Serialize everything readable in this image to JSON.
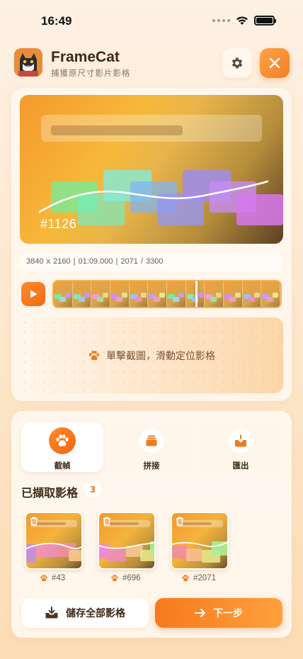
{
  "status_bar": {
    "time": "16:49"
  },
  "header": {
    "title": "FrameCat",
    "subtitle": "捕獲原尺寸影片影格"
  },
  "preview": {
    "frame_label": "#1126",
    "meta": "3840 x 2160  |  01:09.000  |  2071 / 3300"
  },
  "timeline": {
    "playhead_position": 0.63
  },
  "tapzone": {
    "hint": "單擊截圖，滑動定位影格"
  },
  "tools": [
    {
      "label": "截幀",
      "icon": "paw-icon",
      "active": true
    },
    {
      "label": "拼接",
      "icon": "stack-icon",
      "active": false
    },
    {
      "label": "匯出",
      "icon": "export-icon",
      "active": false
    }
  ],
  "captured": {
    "title": "已擷取影格",
    "count": "3",
    "items": [
      {
        "label": "#43"
      },
      {
        "label": "#696"
      },
      {
        "label": "#2071"
      }
    ]
  },
  "actions": {
    "save_all": "儲存全部影格",
    "next": "下一步"
  },
  "colors": {
    "accent": "#F57A1C",
    "background": "#FDF1E4"
  }
}
